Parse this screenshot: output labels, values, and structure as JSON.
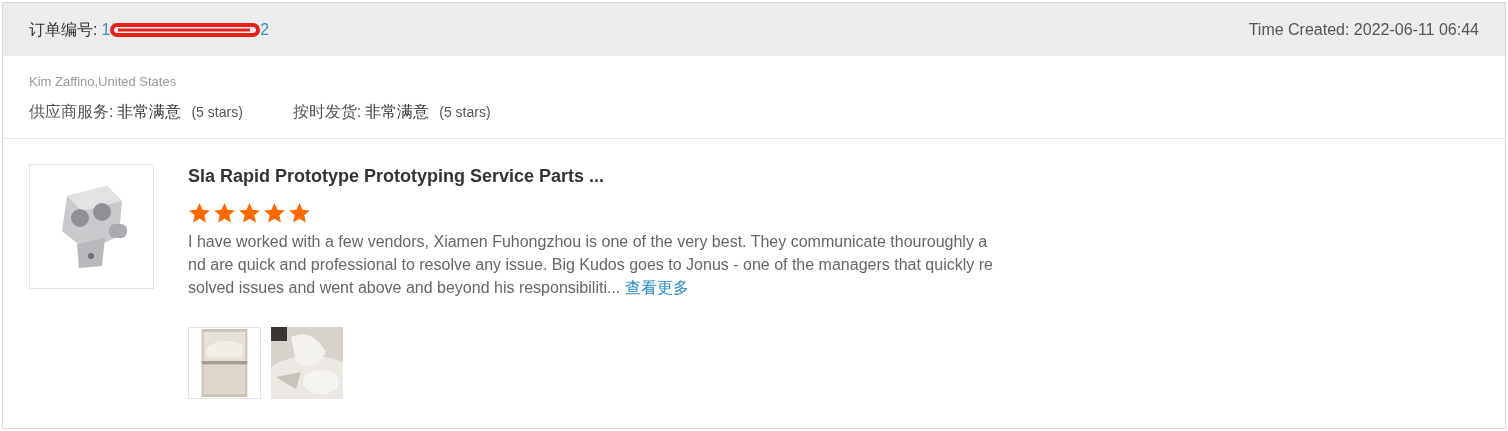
{
  "order": {
    "label": "订单编号:",
    "number_start": "1",
    "number_end": "2",
    "redacted": true,
    "time_created": "Time Created: 2022-06-11 06:44"
  },
  "buyer": "Kim Zaffino,United States",
  "ratings": [
    {
      "label": "供应商服务:",
      "value": "非常满意",
      "note": "(5 stars)"
    },
    {
      "label": "按时发货:",
      "value": "非常满意",
      "note": "(5 stars)"
    }
  ],
  "product": {
    "title": "Sla Rapid Prototype Prototyping Service Parts ...",
    "stars": 5,
    "review": "I have worked with a few vendors, Xiamen Fuhongzhou is one of the very best. They communicate thouroughly and are quick and professional to resolve any issue.  Big Kudos goes to Jonus  - one of the managers that quickly resolved issues and went above and beyond his responsibiliti...",
    "more_link": "查看更多",
    "photos": [
      {
        "kind": "picture"
      },
      {
        "kind": "picture"
      }
    ]
  }
}
